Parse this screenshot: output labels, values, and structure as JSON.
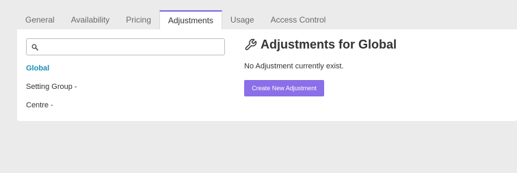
{
  "tabs": [
    {
      "label": "General"
    },
    {
      "label": "Availability"
    },
    {
      "label": "Pricing"
    },
    {
      "label": "Adjustments"
    },
    {
      "label": "Usage"
    },
    {
      "label": "Access Control"
    }
  ],
  "active_tab": "Adjustments",
  "search": {
    "value": "",
    "placeholder": "",
    "icon": "search-icon"
  },
  "tree": {
    "items": [
      {
        "label": "Global",
        "selected": true
      },
      {
        "label": "Setting Group",
        "toggle": "-"
      },
      {
        "label": "Centre",
        "toggle": "-"
      }
    ]
  },
  "content": {
    "icon": "wrench-icon",
    "title": "Adjustments for Global",
    "empty_message": "No Adjustment currently exist.",
    "create_button_label": "Create New Adjustment"
  },
  "colors": {
    "accent": "#8a6fe8",
    "active_tab_border": "#7e68e6",
    "selected_link": "#1a8fb5",
    "background": "#ebebeb",
    "panel": "#ffffff"
  }
}
